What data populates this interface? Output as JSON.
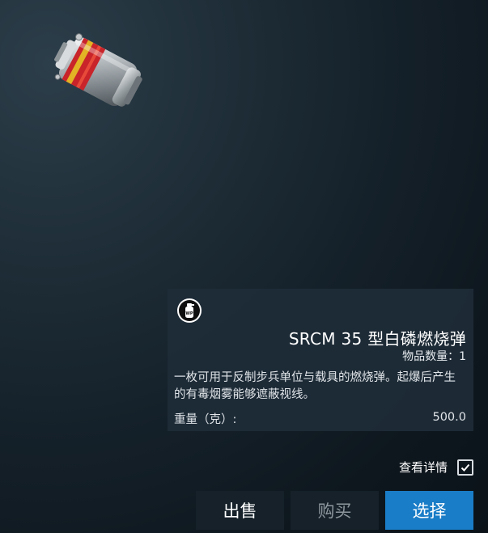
{
  "item": {
    "image_icon": "incendiary-grenade",
    "badge_icon": "wp-grenade-icon",
    "name": "SRCM 35 型白磷燃烧弹",
    "quantity_text": "物品数量：1",
    "description": "一枚可用于反制步兵单位与载具的燃烧弹。起爆后产生的有毒烟雾能够遮蔽视线。",
    "weight_label": "重量（克）:",
    "weight_value": "500.0"
  },
  "details_toggle": {
    "label": "查看详情",
    "checked": true
  },
  "actions": {
    "sell_label": "出售",
    "buy_label": "购买",
    "select_label": "选择"
  },
  "colors": {
    "background": "#15212a",
    "card": "#1e2c38",
    "select_button": "#1a7dc7",
    "disabled_text": "#8d969d"
  }
}
